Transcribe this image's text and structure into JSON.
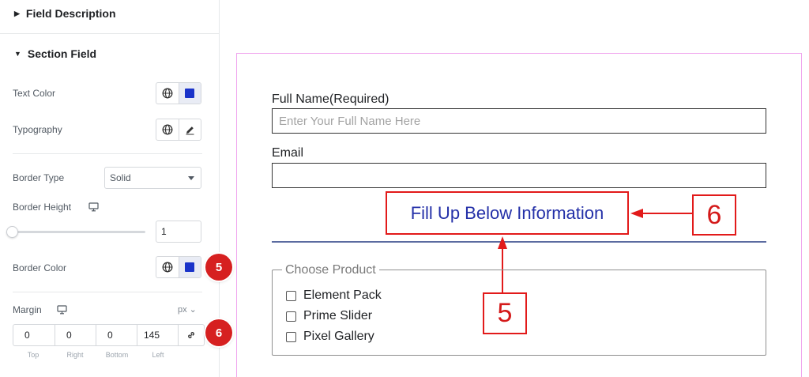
{
  "panel": {
    "field_description_title": "Field Description",
    "section_field_title": "Section Field",
    "text_color_label": "Text Color",
    "typography_label": "Typography",
    "border_type_label": "Border Type",
    "border_type_value": "Solid",
    "border_height_label": "Border Height",
    "border_height_value": "1",
    "border_color_label": "Border Color",
    "margin_label": "Margin",
    "margin_unit": "px ⌄",
    "margin": {
      "top": "0",
      "right": "0",
      "bottom": "0",
      "left": "145",
      "top_label": "Top",
      "right_label": "Right",
      "bottom_label": "Bottom",
      "left_label": "Left"
    },
    "border_height_slider_fraction": 0.0,
    "badges": {
      "border_color": "5",
      "margin": "6"
    }
  },
  "form": {
    "full_name_label": "Full Name(Required)",
    "full_name_placeholder": "Enter Your Full Name Here",
    "email_label": "Email",
    "email_value": "",
    "section_heading": "Fill Up Below Information",
    "product_legend": "Choose Product",
    "products": [
      "Element Pack",
      "Prime Slider",
      "Pixel Gallery"
    ]
  },
  "annotations": {
    "callout_heading": "6",
    "callout_divider": "5"
  },
  "colors": {
    "swatch": "#1a33c9",
    "badge": "#d62020",
    "callout_border": "#e21a1a",
    "heading_text": "#2430a8",
    "divider": "#5b6ba0",
    "canvas_border": "#f0a6ee"
  },
  "icons": {
    "section_collapsed": "triangle-right-icon",
    "section_expanded": "triangle-down-icon",
    "global": "globe-icon",
    "edit": "pencil-icon",
    "responsive": "desktop-icon",
    "link": "link-icon",
    "dropdown": "caret-down-icon"
  }
}
